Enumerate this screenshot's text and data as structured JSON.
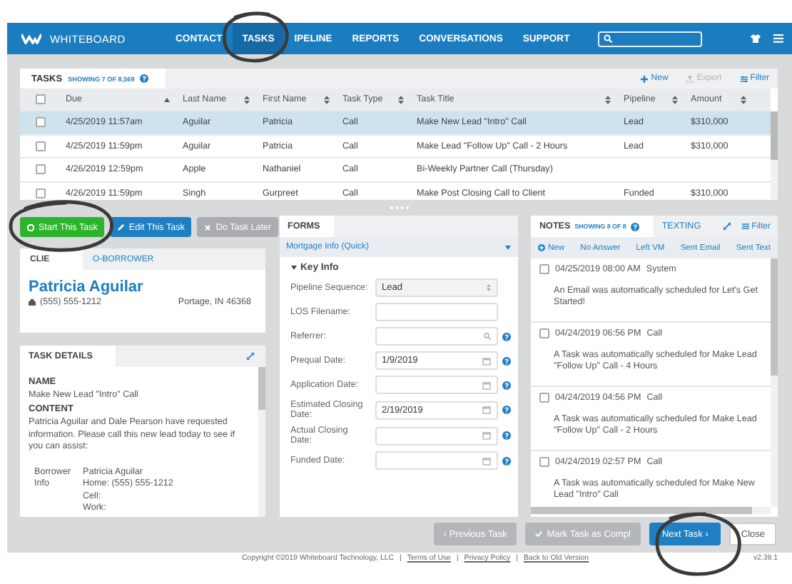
{
  "nav": {
    "logo": "WHITEBOARD",
    "items": [
      {
        "label": "CONTACT",
        "selected": false
      },
      {
        "label": "TASKS",
        "selected": true
      },
      {
        "label": "IPELINE",
        "selected": false
      },
      {
        "label": "REPORTS",
        "selected": false
      },
      {
        "label": "CONVERSATIONS",
        "selected": false
      },
      {
        "label": "SUPPORT",
        "selected": false
      }
    ]
  },
  "tasks": {
    "title": "TASKS",
    "count": "SHOWING 7 OF 8,569",
    "all_checked": false,
    "actions": [
      {
        "label": "New",
        "kind": "new",
        "disabled": false
      },
      {
        "label": "Export",
        "kind": "export",
        "disabled": true
      },
      {
        "label": "Filter",
        "kind": "filter",
        "disabled": false
      }
    ],
    "columns": [
      {
        "label": "Due",
        "sorted": true
      },
      {
        "label": "Last Name",
        "sorted": false
      },
      {
        "label": "First Name",
        "sorted": false
      },
      {
        "label": "Task Type",
        "sorted": false
      },
      {
        "label": "Task Title",
        "sorted": false
      },
      {
        "label": "Pipeline",
        "sorted": false
      },
      {
        "label": "Amount",
        "sorted": false
      }
    ],
    "rows": [
      {
        "selected": true,
        "checked": false,
        "due": "4/25/2019 11:57am",
        "last_name": "Aguilar",
        "first_name": "Patricia",
        "task_type": "Call",
        "task_title": "Make New Lead \"Intro\" Call",
        "pipeline": "Lead",
        "amount": "$310,000"
      },
      {
        "selected": false,
        "checked": false,
        "due": "4/25/2019 11:59pm",
        "last_name": "Aguilar",
        "first_name": "Patricia",
        "task_type": "Call",
        "task_title": "Make Lead \"Follow Up\" Call - 2 Hours",
        "pipeline": "Lead",
        "amount": "$310,000"
      },
      {
        "selected": false,
        "checked": false,
        "due": "4/26/2019 12:59pm",
        "last_name": "Apple",
        "first_name": "Nathaniel",
        "task_type": "Call",
        "task_title": "Bi-Weekly Partner Call (Thursday)"
      },
      {
        "selected": false,
        "checked": false,
        "due": "4/26/2019 11:59pm",
        "last_name": "Singh",
        "first_name": "Gurpreet",
        "task_type": "Call",
        "task_title": "Make Post Closing Call to Client",
        "pipeline": "Funded",
        "amount": "$310,000"
      }
    ]
  },
  "task_actions": [
    {
      "label": "Start This Task",
      "kind": "start"
    },
    {
      "label": "Edit This Task",
      "kind": "edit"
    },
    {
      "label": "Do Task Later",
      "kind": "later"
    }
  ],
  "client": {
    "tabs": [
      {
        "label": "CLIE",
        "selected": true
      },
      {
        "label": "O-BORROWER",
        "selected": false
      }
    ],
    "name": "Patricia Aguilar",
    "phone": "(555) 555-1212",
    "location": "Portage, IN 46368"
  },
  "task_details": {
    "title": "TASK DETAILS",
    "sections": [
      {
        "heading": "NAME",
        "text": "Make New Lead \"Intro\" Call"
      },
      {
        "heading": "CONTENT",
        "text": "Patricia Aguilar and Dale Pearson have requested information. Please call this new lead today to see if you can assist:"
      }
    ],
    "info": {
      "label": "Borrower Info",
      "lines": [
        "Patricia Aguilar",
        "Home: (555) 555-1212",
        "Cell:",
        "Work:"
      ]
    }
  },
  "forms": {
    "title": "FORMS",
    "form": "Mortgage Info (Quick)",
    "section": "Key Info",
    "expanded": true,
    "fields": [
      {
        "label": "Pipeline Sequence:",
        "kind": "select",
        "value": "Lead",
        "help": false
      },
      {
        "label": "LOS Filename:",
        "kind": "text",
        "help": false
      },
      {
        "label": "Referrer:",
        "kind": "search",
        "help": true
      },
      {
        "label": "Prequal Date:",
        "kind": "date",
        "value": "1/9/2019",
        "help": true
      },
      {
        "label": "Application Date:",
        "kind": "date",
        "help": true
      },
      {
        "label": "Estimated Closing Date:",
        "kind": "date",
        "value": "2/19/2019",
        "help": true
      },
      {
        "label": "Actual Closing Date:",
        "kind": "date",
        "help": true
      },
      {
        "label": "Funded Date:",
        "kind": "date",
        "help": true
      }
    ]
  },
  "notes": {
    "tabs": [
      {
        "label": "NOTES",
        "count": "SHOWING 8 OF 8",
        "selected": true
      },
      {
        "label": "TEXTING",
        "selected": false
      }
    ],
    "filter": "Filter",
    "quick_actions": [
      {
        "label": "New",
        "kind": "new"
      },
      {
        "label": "No Answer",
        "kind": "plain"
      },
      {
        "label": "Left VM",
        "kind": "plain"
      },
      {
        "label": "Sent Email",
        "kind": "plain"
      },
      {
        "label": "Sent Text",
        "kind": "plain"
      }
    ],
    "items": [
      {
        "checked": false,
        "date": "04/25/2019 08:00 AM",
        "type": "System",
        "text": "An Email was automatically scheduled for Let's Get Started!"
      },
      {
        "checked": false,
        "date": "04/24/2019 06:56 PM",
        "type": "Call",
        "text": "A Task was automatically scheduled for Make Lead \"Follow Up\" Call - 4 Hours"
      },
      {
        "checked": false,
        "date": "04/24/2019 04:56 PM",
        "type": "Call",
        "text": "A Task was automatically scheduled for Make Lead \"Follow Up\" Call - 2 Hours"
      },
      {
        "checked": false,
        "date": "04/24/2019 02:57 PM",
        "type": "Call",
        "text": "A Task was automatically scheduled for Make New Lead \"Intro\" Call"
      }
    ]
  },
  "footer_buttons": [
    {
      "label": "‹ Previous Task",
      "kind": "prev"
    },
    {
      "label": "Mark Task as Compl",
      "kind": "complete"
    },
    {
      "label": "Next Task ›",
      "kind": "next"
    },
    {
      "label": "Close",
      "kind": "close"
    }
  ],
  "footer": {
    "copyright": "Copyright ©2019 Whiteboard Technology, LLC",
    "separator": "|",
    "links": [
      "Terms of Use",
      "Privacy Policy",
      "Back to Old Version"
    ],
    "version": "v2.39.1"
  }
}
